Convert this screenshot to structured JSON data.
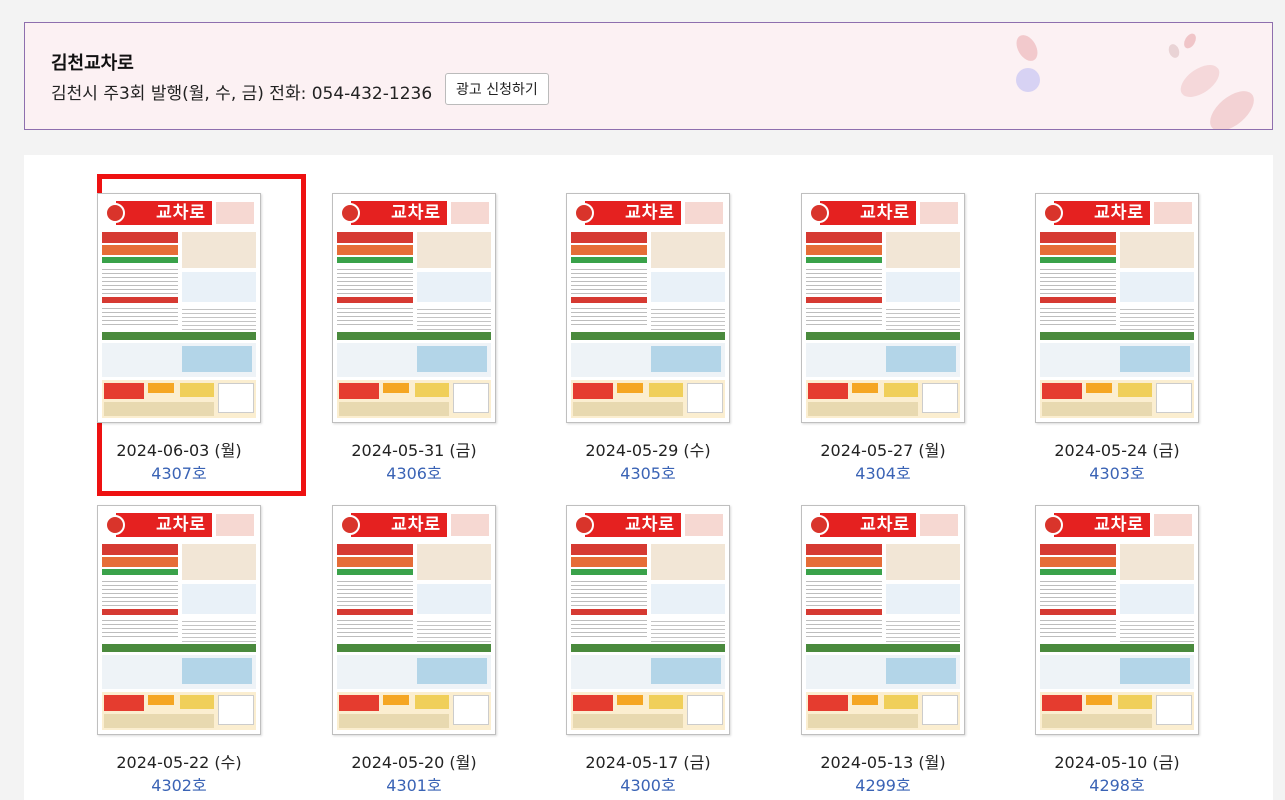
{
  "header": {
    "title": "김천교차로",
    "info": "김천시 주3회 발행(월, 수, 금) 전화: 054-432-1236",
    "ad_button_label": "광고 신청하기"
  },
  "thumbnail_logo": "교차로",
  "issues": [
    {
      "date": "2024-06-03 (월)",
      "issue": "4307호",
      "selected": true
    },
    {
      "date": "2024-05-31 (금)",
      "issue": "4306호"
    },
    {
      "date": "2024-05-29 (수)",
      "issue": "4305호"
    },
    {
      "date": "2024-05-27 (월)",
      "issue": "4304호"
    },
    {
      "date": "2024-05-24 (금)",
      "issue": "4303호"
    },
    {
      "date": "2024-05-22 (수)",
      "issue": "4302호"
    },
    {
      "date": "2024-05-20 (월)",
      "issue": "4301호"
    },
    {
      "date": "2024-05-17 (금)",
      "issue": "4300호"
    },
    {
      "date": "2024-05-13 (월)",
      "issue": "4299호"
    },
    {
      "date": "2024-05-10 (금)",
      "issue": "4298호"
    }
  ],
  "colors": {
    "header_bg": "#fcf1f3",
    "header_border": "#8e6fae",
    "selection_border": "#ee1111",
    "issue_link": "#3a63b5",
    "logo_red": "#e52120"
  }
}
